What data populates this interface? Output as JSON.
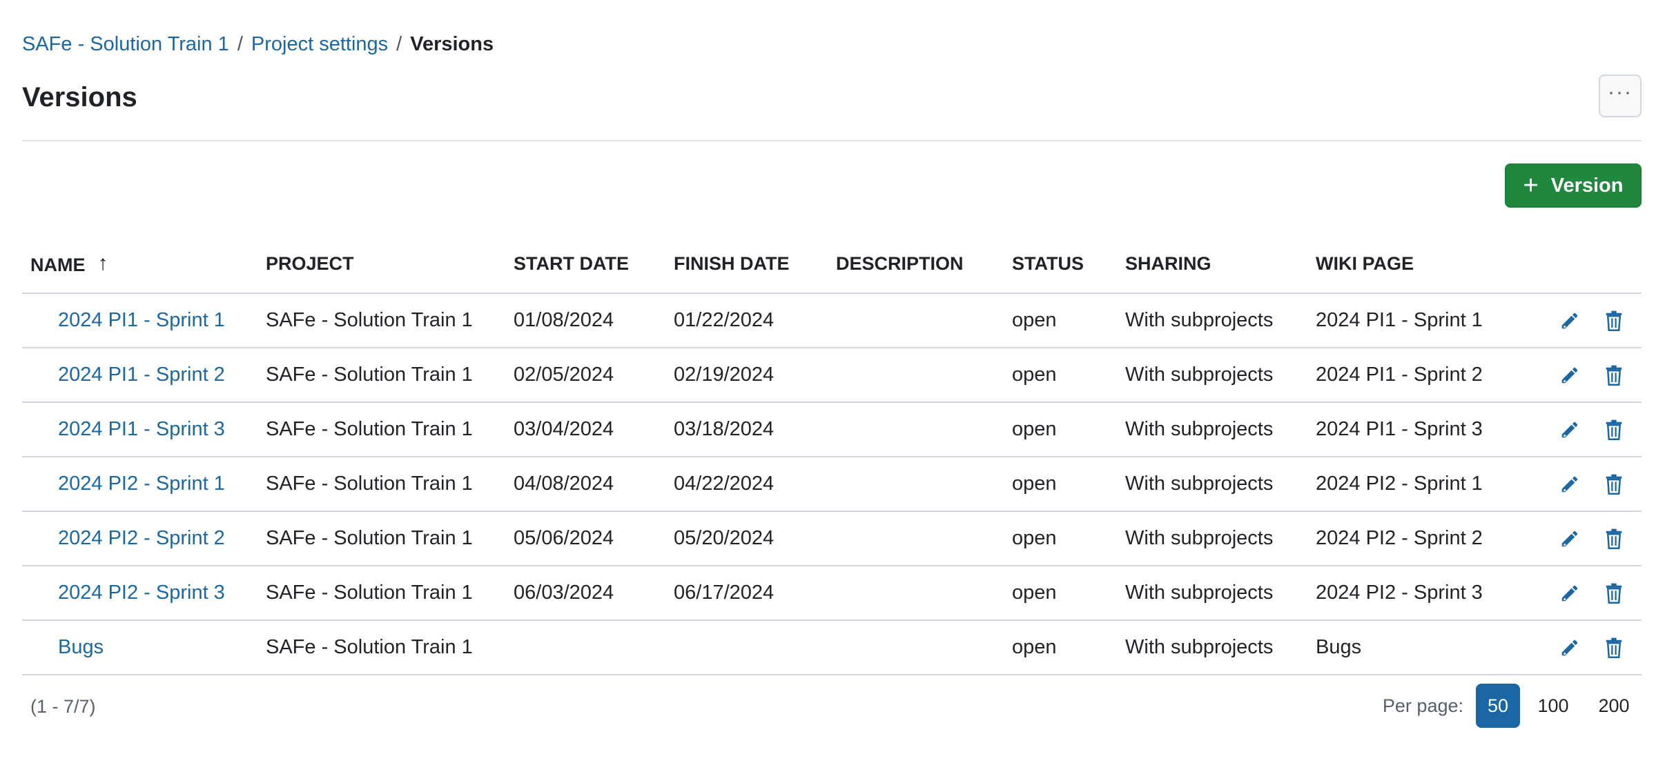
{
  "breadcrumb": {
    "items": [
      "SAFe - Solution Train 1",
      "Project settings"
    ],
    "current": "Versions",
    "separator": "/"
  },
  "page": {
    "title": "Versions",
    "more_label": "···"
  },
  "toolbar": {
    "add_label": "Version"
  },
  "table": {
    "headers": {
      "name": "NAME",
      "project": "PROJECT",
      "start_date": "START DATE",
      "finish_date": "FINISH DATE",
      "description": "DESCRIPTION",
      "status": "STATUS",
      "sharing": "SHARING",
      "wiki_page": "WIKI PAGE"
    },
    "sort_arrow": "↑",
    "rows": [
      {
        "name": "2024 PI1 - Sprint 1",
        "project": "SAFe - Solution Train 1",
        "start": "01/08/2024",
        "finish": "01/22/2024",
        "description": "",
        "status": "open",
        "sharing": "With subprojects",
        "wiki": "2024 PI1 - Sprint 1"
      },
      {
        "name": "2024 PI1 - Sprint 2",
        "project": "SAFe - Solution Train 1",
        "start": "02/05/2024",
        "finish": "02/19/2024",
        "description": "",
        "status": "open",
        "sharing": "With subprojects",
        "wiki": "2024 PI1 - Sprint 2"
      },
      {
        "name": "2024 PI1 - Sprint 3",
        "project": "SAFe - Solution Train 1",
        "start": "03/04/2024",
        "finish": "03/18/2024",
        "description": "",
        "status": "open",
        "sharing": "With subprojects",
        "wiki": "2024 PI1 - Sprint 3"
      },
      {
        "name": "2024 PI2 - Sprint 1",
        "project": "SAFe - Solution Train 1",
        "start": "04/08/2024",
        "finish": "04/22/2024",
        "description": "",
        "status": "open",
        "sharing": "With subprojects",
        "wiki": "2024 PI2 - Sprint 1"
      },
      {
        "name": "2024 PI2 - Sprint 2",
        "project": "SAFe - Solution Train 1",
        "start": "05/06/2024",
        "finish": "05/20/2024",
        "description": "",
        "status": "open",
        "sharing": "With subprojects",
        "wiki": "2024 PI2 - Sprint 2"
      },
      {
        "name": "2024 PI2 - Sprint 3",
        "project": "SAFe - Solution Train 1",
        "start": "06/03/2024",
        "finish": "06/17/2024",
        "description": "",
        "status": "open",
        "sharing": "With subprojects",
        "wiki": "2024 PI2 - Sprint 3"
      },
      {
        "name": "Bugs",
        "project": "SAFe - Solution Train 1",
        "start": "",
        "finish": "",
        "description": "",
        "status": "open",
        "sharing": "With subprojects",
        "wiki": "Bugs"
      }
    ]
  },
  "pagination": {
    "count": "(1 - 7/7)",
    "per_page_label": "Per page:",
    "options": [
      "50",
      "100",
      "200"
    ],
    "selected": "50"
  },
  "colors": {
    "link": "#1a67a3",
    "primary_button": "#1f883d",
    "active_page": "#1a67a3"
  },
  "icons": {
    "edit": "pencil-icon",
    "delete": "trash-icon",
    "more": "ellipsis-icon",
    "add": "plus-icon"
  }
}
